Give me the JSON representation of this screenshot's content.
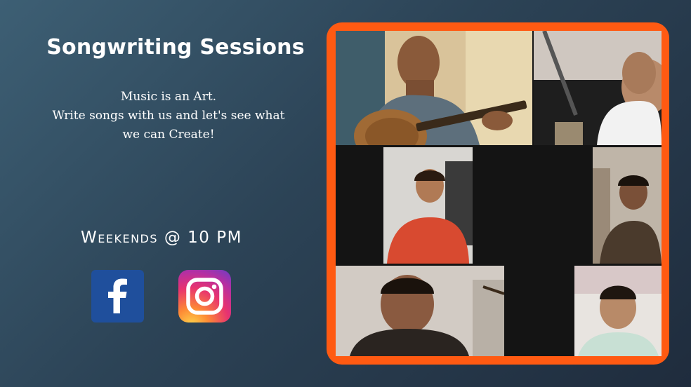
{
  "promo": {
    "title": "Songwriting Sessions",
    "tagline_lines": [
      "Music is an Art.",
      "Write songs with us and let's see what",
      "we can Create!"
    ],
    "schedule": "Weekends @ 10 PM"
  },
  "social": {
    "facebook_icon": "facebook-icon",
    "instagram_icon": "instagram-icon"
  },
  "colors": {
    "frame_border": "#ff5a12",
    "background_start": "#3d5f74",
    "background_end": "#1f2c3d",
    "facebook_blue": "#1f4f9c"
  },
  "video_grid": {
    "participants": [
      {
        "id": "p1",
        "icon": "guitarist-video-tile"
      },
      {
        "id": "p2",
        "icon": "participant-video-tile"
      },
      {
        "id": "p3",
        "icon": "participant-video-tile"
      },
      {
        "id": "p4",
        "icon": "participant-video-tile"
      },
      {
        "id": "p5",
        "icon": "participant-video-tile"
      },
      {
        "id": "p6",
        "icon": "participant-video-tile"
      }
    ]
  }
}
